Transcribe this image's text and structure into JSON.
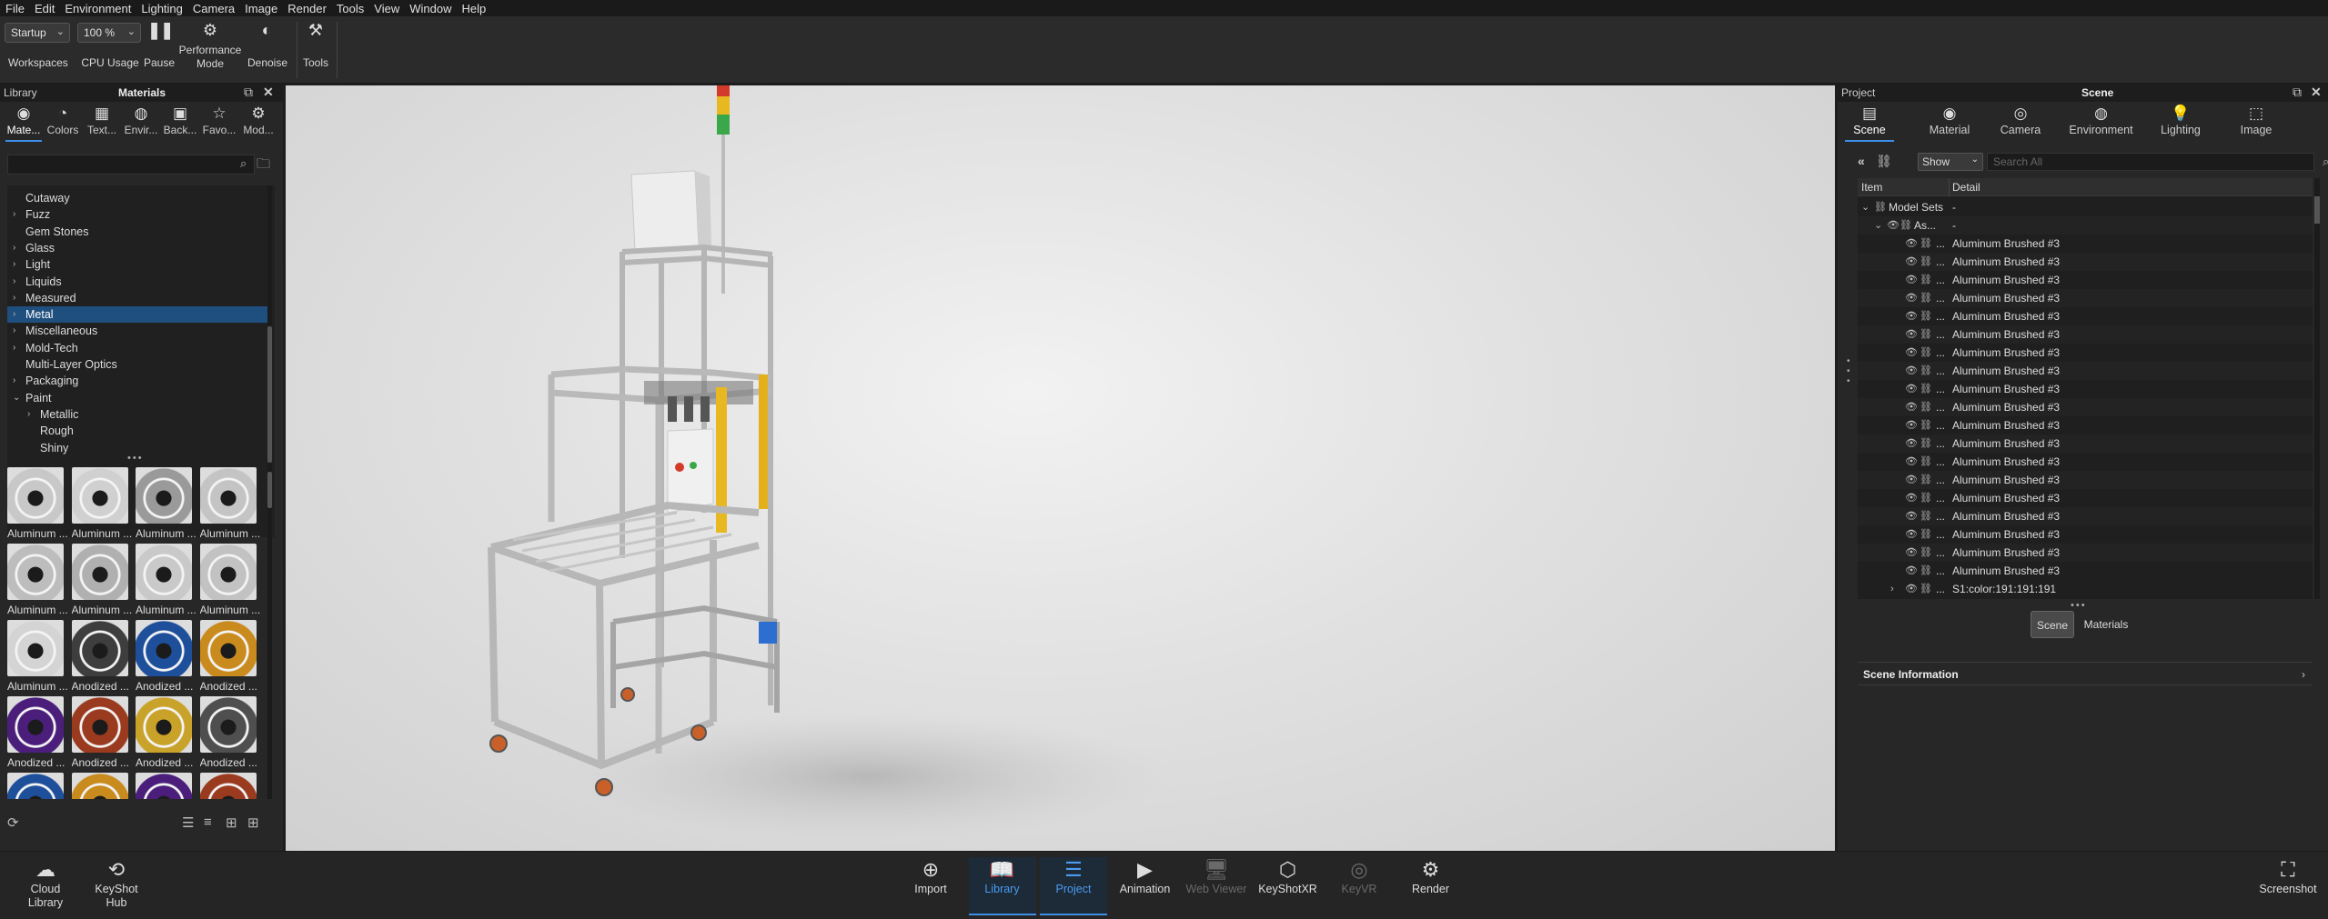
{
  "menu": [
    "File",
    "Edit",
    "Environment",
    "Lighting",
    "Camera",
    "Image",
    "Render",
    "Tools",
    "View",
    "Window",
    "Help"
  ],
  "toolbar": {
    "workspace_value": "Startup",
    "workspaces_label": "Workspaces",
    "cpu_value": "100 %",
    "cpu_label": "CPU Usage",
    "pause_label": "Pause",
    "performance_label_1": "Performance",
    "performance_label_2": "Mode",
    "denoise_label": "Denoise",
    "tools_label": "Tools"
  },
  "library": {
    "panel_title": "Library",
    "section_title": "Materials",
    "tabs": [
      "Mate...",
      "Colors",
      "Text...",
      "Envir...",
      "Back...",
      "Favo...",
      "Mod..."
    ],
    "tree": [
      {
        "name": "Cutaway",
        "arrow": "",
        "indent": 0
      },
      {
        "name": "Fuzz",
        "arrow": "›",
        "indent": 0
      },
      {
        "name": "Gem Stones",
        "arrow": "",
        "indent": 0
      },
      {
        "name": "Glass",
        "arrow": "›",
        "indent": 0
      },
      {
        "name": "Light",
        "arrow": "›",
        "indent": 0
      },
      {
        "name": "Liquids",
        "arrow": "›",
        "indent": 0
      },
      {
        "name": "Measured",
        "arrow": "›",
        "indent": 0
      },
      {
        "name": "Metal",
        "arrow": "›",
        "indent": 0,
        "selected": true
      },
      {
        "name": "Miscellaneous",
        "arrow": "›",
        "indent": 0
      },
      {
        "name": "Mold-Tech",
        "arrow": "›",
        "indent": 0
      },
      {
        "name": "Multi-Layer Optics",
        "arrow": "",
        "indent": 0
      },
      {
        "name": "Packaging",
        "arrow": "›",
        "indent": 0
      },
      {
        "name": "Paint",
        "arrow": "⌄",
        "indent": 0
      },
      {
        "name": "Metallic",
        "arrow": "›",
        "indent": 1
      },
      {
        "name": "Rough",
        "arrow": "",
        "indent": 1
      },
      {
        "name": "Shiny",
        "arrow": "",
        "indent": 1
      }
    ],
    "materials": [
      {
        "label": "Aluminum ...",
        "color": "#c8c8c8"
      },
      {
        "label": "Aluminum ...",
        "color": "#d0d0d0"
      },
      {
        "label": "Aluminum ...",
        "color": "#9a9a9a"
      },
      {
        "label": "Aluminum ...",
        "color": "#c4c4c4"
      },
      {
        "label": "Aluminum ...",
        "color": "#bdbdbd"
      },
      {
        "label": "Aluminum ...",
        "color": "#b0b0b0"
      },
      {
        "label": "Aluminum ...",
        "color": "#c9c9c9"
      },
      {
        "label": "Aluminum ...",
        "color": "#c2c2c2"
      },
      {
        "label": "Aluminum ...",
        "color": "#d4d4d4"
      },
      {
        "label": "Anodized ...",
        "color": "#3e3e3e"
      },
      {
        "label": "Anodized ...",
        "color": "#1e4f9a"
      },
      {
        "label": "Anodized ...",
        "color": "#c98a1e"
      },
      {
        "label": "Anodized ...",
        "color": "#4a1e7a"
      },
      {
        "label": "Anodized ...",
        "color": "#9a3a1e"
      },
      {
        "label": "Anodized ...",
        "color": "#c9a22a"
      },
      {
        "label": "Anodized ...",
        "color": "#4f4f4f"
      },
      {
        "label": "",
        "color": "#1e4f9a"
      },
      {
        "label": "",
        "color": "#c98a1e"
      },
      {
        "label": "",
        "color": "#4a1e7a"
      },
      {
        "label": "",
        "color": "#9a3a1e"
      }
    ]
  },
  "project": {
    "panel_title": "Project",
    "section_title": "Scene",
    "tabs": [
      "Scene",
      "Material",
      "Camera",
      "Environment",
      "Lighting",
      "Image"
    ],
    "show_value": "Show",
    "search_placeholder": "Search All",
    "col_item": "Item",
    "col_detail": "Detail",
    "model_sets_label": "Model Sets",
    "model_sets_detail": "-",
    "assembly_label": "As...",
    "assembly_detail": "-",
    "rows": [
      "Aluminum Brushed #3",
      "Aluminum Brushed #3",
      "Aluminum Brushed #3",
      "Aluminum Brushed #3",
      "Aluminum Brushed #3",
      "Aluminum Brushed #3",
      "Aluminum Brushed #3",
      "Aluminum Brushed #3",
      "Aluminum Brushed #3",
      "Aluminum Brushed #3",
      "Aluminum Brushed #3",
      "Aluminum Brushed #3",
      "Aluminum Brushed #3",
      "Aluminum Brushed #3",
      "Aluminum Brushed #3",
      "Aluminum Brushed #3",
      "Aluminum Brushed #3",
      "Aluminum Brushed #3",
      "Aluminum Brushed #3"
    ],
    "last_row": "S1:color:191:191:191",
    "row_dots": "...",
    "seg_scene": "Scene",
    "seg_materials": "Materials",
    "scene_info": "Scene Information"
  },
  "bottom": {
    "cloud_library": [
      "Cloud",
      "Library"
    ],
    "keyshot_hub": [
      "KeyShot",
      "Hub"
    ],
    "buttons": [
      {
        "label": "Import",
        "icon": "import-icon",
        "state": "normal"
      },
      {
        "label": "Library",
        "icon": "library-icon",
        "state": "active"
      },
      {
        "label": "Project",
        "icon": "project-icon",
        "state": "active"
      },
      {
        "label": "Animation",
        "icon": "animation-icon",
        "state": "normal"
      },
      {
        "label": "Web Viewer",
        "icon": "web-viewer-icon",
        "state": "disabled"
      },
      {
        "label": "KeyShotXR",
        "icon": "keyshotxr-icon",
        "state": "normal"
      },
      {
        "label": "KeyVR",
        "icon": "keyvr-icon",
        "state": "disabled"
      },
      {
        "label": "Render",
        "icon": "render-icon",
        "state": "normal"
      }
    ],
    "screenshot_label": "Screenshot"
  },
  "colors": {
    "accent": "#3d8ee8",
    "selection": "#1f4f7e",
    "frame_yellow": "#e8b820",
    "caster_orange": "#c9602a",
    "signal_red": "#d23a2a",
    "signal_green": "#3aa84a"
  }
}
